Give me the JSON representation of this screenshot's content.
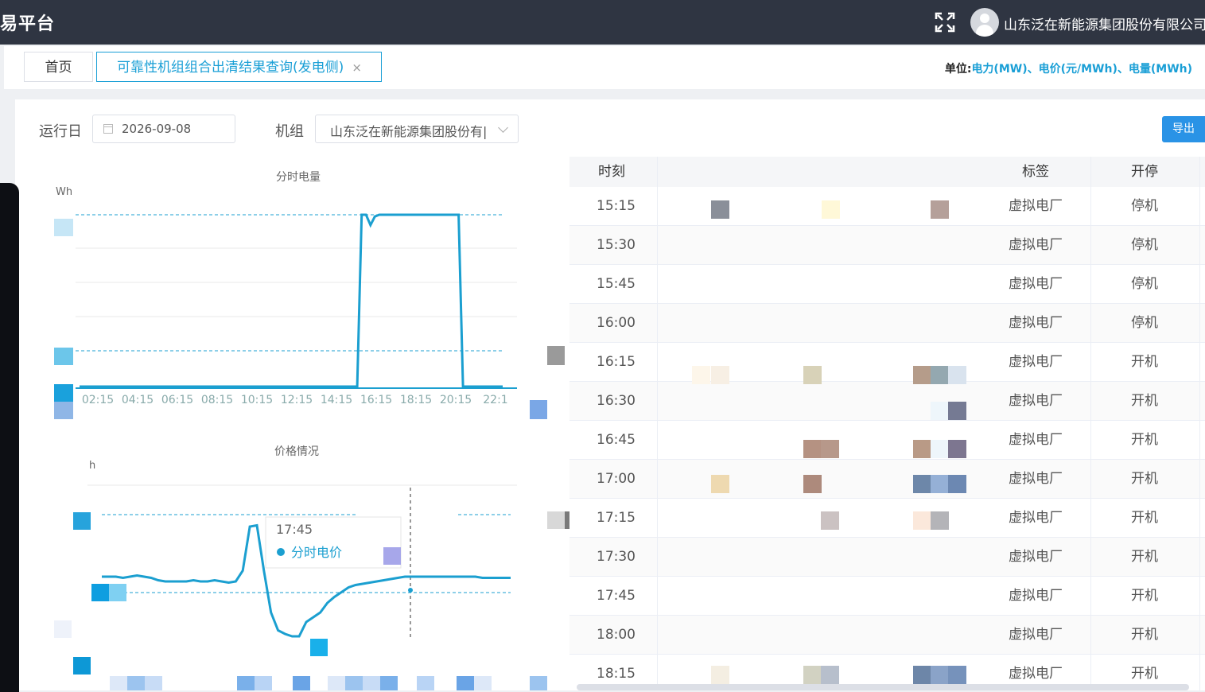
{
  "topbar": {
    "brand": "易平台",
    "company": "山东泛在新能源集团股份有限公司"
  },
  "tabs": {
    "home": "首页",
    "active": "可靠性机组组合出清结果查询(发电侧)",
    "close": "×"
  },
  "unit": {
    "label": "单位:",
    "text": "电力(MW)、电价(元/MWh)、电量(MWh)"
  },
  "filters": {
    "date_label": "运行日",
    "date_value": "2026-09-08",
    "unit_label": "机组",
    "unit_value": "山东泛在新能源集团股份有|",
    "export": "导出"
  },
  "chart1": {
    "title": "分时电量",
    "ylabel_fragment": "Wh"
  },
  "chart2": {
    "title": "价格情况",
    "ylabel_fragment": "h",
    "tooltip_time": "17:45",
    "tooltip_series": "分时电价"
  },
  "chart_data": [
    {
      "type": "line",
      "title": "分时电量",
      "ylabel": "Wh",
      "xticks": [
        "02:15",
        "04:15",
        "06:15",
        "08:15",
        "10:15",
        "12:15",
        "14:15",
        "16:15",
        "18:15",
        "20:15",
        "22:1"
      ],
      "series": [
        {
          "values": [
            0,
            0,
            0,
            0,
            0,
            0,
            0,
            0,
            0,
            0,
            0,
            0,
            0,
            0,
            0,
            0,
            0,
            0,
            0,
            0,
            0,
            0,
            0,
            0,
            0,
            0,
            0,
            0,
            0,
            0,
            0,
            0,
            0,
            0,
            0,
            0,
            0,
            0,
            0,
            0,
            0,
            0,
            0,
            0,
            0,
            0,
            0,
            0,
            0,
            0,
            0,
            0,
            0,
            0,
            0,
            0,
            0,
            0,
            0,
            0,
            0,
            0,
            0,
            0,
            1,
            1,
            0.94,
            0.99,
            1,
            1,
            1,
            1,
            1,
            1,
            1,
            1,
            1,
            1,
            1,
            1,
            1,
            1,
            1,
            1,
            1,
            1,
            1,
            0,
            0,
            0,
            0,
            0,
            0,
            0,
            0,
            0,
            0
          ]
        }
      ]
    },
    {
      "type": "line",
      "title": "价格情况",
      "ylabel": "h",
      "series": [
        {
          "name": "分时电价",
          "values": [
            0.5,
            0.5,
            0.5,
            0.49,
            0.5,
            0.51,
            0.5,
            0.49,
            0.47,
            0.46,
            0.46,
            0.46,
            0.46,
            0.47,
            0.46,
            0.46,
            0.47,
            0.46,
            0.45,
            0.46,
            0.55,
            0.92,
            0.93,
            0.55,
            0.2,
            0.05,
            0.02,
            0.0,
            0.0,
            0.12,
            0.16,
            0.2,
            0.28,
            0.33,
            0.37,
            0.41,
            0.43,
            0.44,
            0.45,
            0.46,
            0.47,
            0.48,
            0.49,
            0.5,
            0.5,
            0.5,
            0.5,
            0.5,
            0.5,
            0.5,
            0.5,
            0.5,
            0.5,
            0.5,
            0.49,
            0.49,
            0.49,
            0.49,
            0.49
          ]
        }
      ]
    }
  ],
  "table": {
    "headers": {
      "time": "时刻",
      "tag": "标签",
      "status": "开停"
    },
    "rows": [
      {
        "time": "15:15",
        "tag": "虚拟电厂",
        "status": "停机"
      },
      {
        "time": "15:30",
        "tag": "虚拟电厂",
        "status": "停机"
      },
      {
        "time": "15:45",
        "tag": "虚拟电厂",
        "status": "停机"
      },
      {
        "time": "16:00",
        "tag": "虚拟电厂",
        "status": "停机"
      },
      {
        "time": "16:15",
        "tag": "虚拟电厂",
        "status": "开机"
      },
      {
        "time": "16:30",
        "tag": "虚拟电厂",
        "status": "开机"
      },
      {
        "time": "16:45",
        "tag": "虚拟电厂",
        "status": "开机"
      },
      {
        "time": "17:00",
        "tag": "虚拟电厂",
        "status": "开机"
      },
      {
        "time": "17:15",
        "tag": "虚拟电厂",
        "status": "开机"
      },
      {
        "time": "17:30",
        "tag": "虚拟电厂",
        "status": "开机"
      },
      {
        "time": "17:45",
        "tag": "虚拟电厂",
        "status": "开机"
      },
      {
        "time": "18:00",
        "tag": "虚拟电厂",
        "status": "开机"
      },
      {
        "time": "18:15",
        "tag": "虚拟电厂",
        "status": "开机"
      }
    ]
  },
  "colors": {
    "accent": "#1a9fd6",
    "line": "#1b9fd0",
    "topbar": "#2f3542"
  }
}
